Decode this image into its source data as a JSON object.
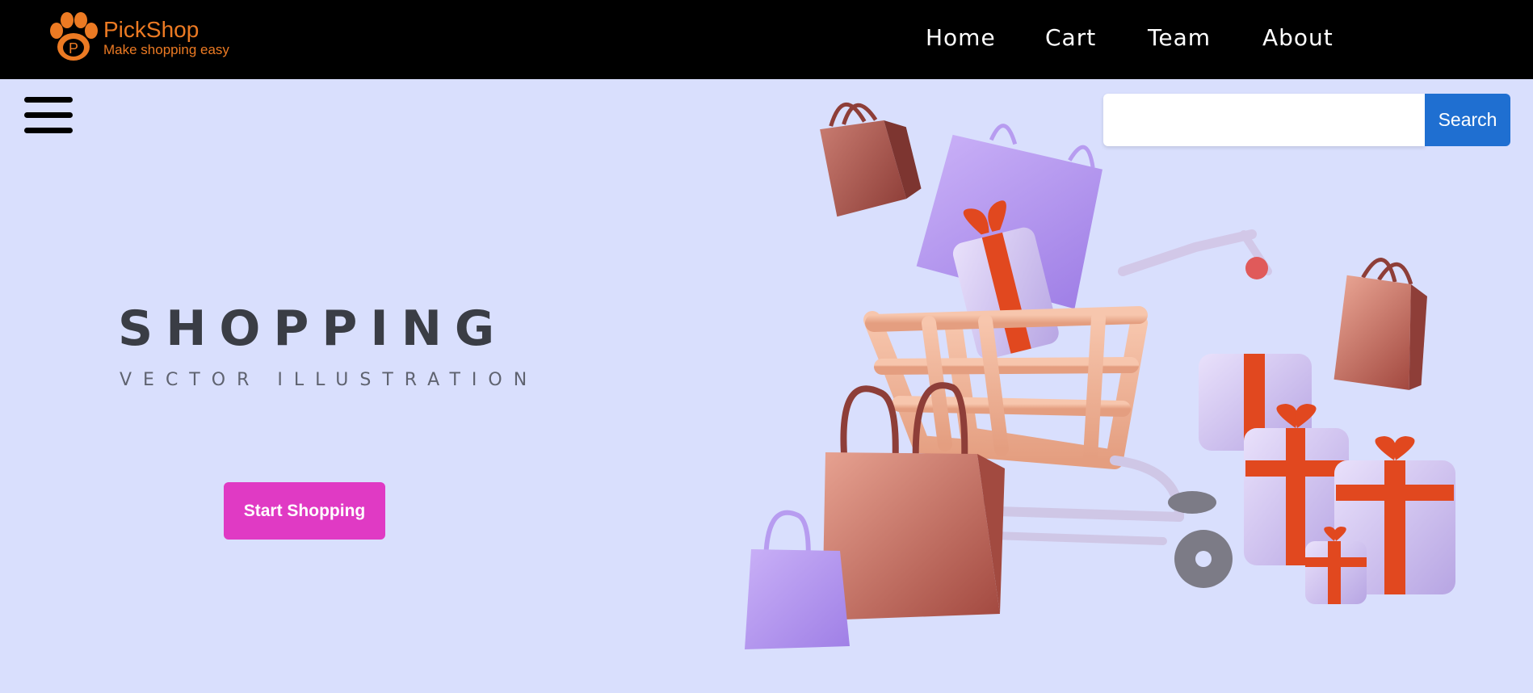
{
  "brand": {
    "name": "PickShop",
    "tagline": "Make shopping easy",
    "logo_letter": "P",
    "color": "#ec7a23"
  },
  "nav": {
    "items": [
      {
        "label": "Home"
      },
      {
        "label": "Cart"
      },
      {
        "label": "Team"
      },
      {
        "label": "About"
      }
    ]
  },
  "menu": {
    "icon": "hamburger-menu-icon"
  },
  "search": {
    "value": "",
    "placeholder": "",
    "button_label": "Search",
    "button_color": "#1f6fd1"
  },
  "hero": {
    "title": "SHOPPING",
    "subtitle": "VECTOR ILLUSTRATION",
    "cta_label": "Start Shopping",
    "cta_color": "#e03ac4",
    "background": "#d9dffd"
  },
  "illustration": {
    "subject": "shopping-cart-with-bags-and-gifts"
  }
}
